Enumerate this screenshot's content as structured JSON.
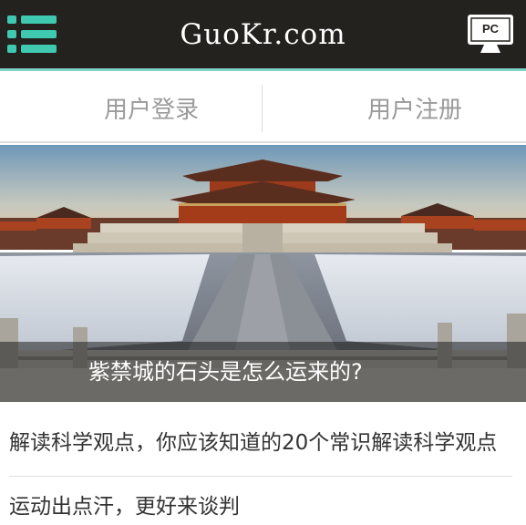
{
  "header": {
    "site_title": "GuoKr.com",
    "menu_icon": "hamburger-menu-icon",
    "pc_icon": "desktop-monitor-icon",
    "pc_label": "PC",
    "bg_color": "#23221f",
    "accent_color": "#3fc9b0"
  },
  "auth": {
    "login_label": "用户登录",
    "register_label": "用户注册"
  },
  "banner": {
    "caption": "紫禁城的石头是怎么运来的?"
  },
  "articles": [
    {
      "title": "解读科学观点，你应该知道的20个常识解读科学观点"
    },
    {
      "title": "运动出点汗，更好来谈判"
    }
  ]
}
